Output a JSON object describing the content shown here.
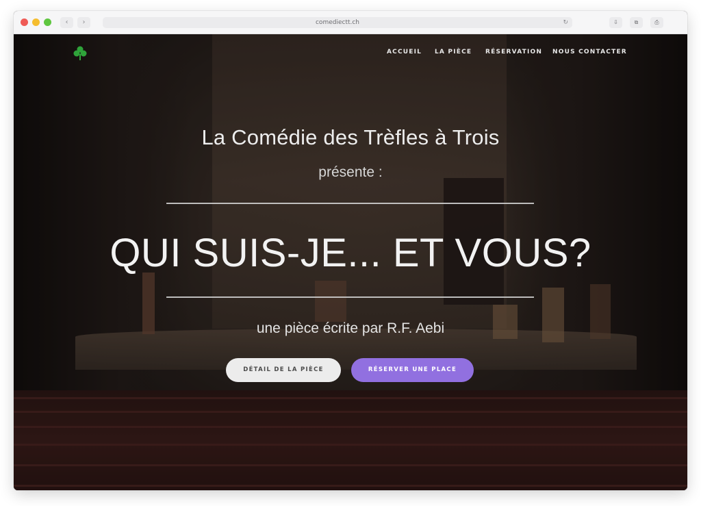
{
  "browser": {
    "url": "comediectt.ch",
    "back_icon": "‹",
    "forward_icon": "›",
    "reload_icon": "↻",
    "tool_icons": [
      "⇩",
      "⧉",
      "⎙"
    ]
  },
  "nav": {
    "items": [
      "ACCUEIL",
      "LA PIÈCE",
      "RÉSERVATION",
      "NOUS CONTACTER"
    ],
    "logo_icon": "clover-icon",
    "logo_color": "#2fa33a"
  },
  "hero": {
    "company": "La Comédie des Trèfles à Trois",
    "presents": "présente :",
    "title": "QUI SUIS-JE... ET VOUS?",
    "author": "une pièce écrite par R.F. Aebi",
    "buttons": {
      "detail": "DÉTAIL DE LA PIÈCE",
      "reserve": "RÉSERVER UNE PLACE"
    }
  },
  "colors": {
    "accent": "#9170e0",
    "secondary_button": "#ececec"
  }
}
